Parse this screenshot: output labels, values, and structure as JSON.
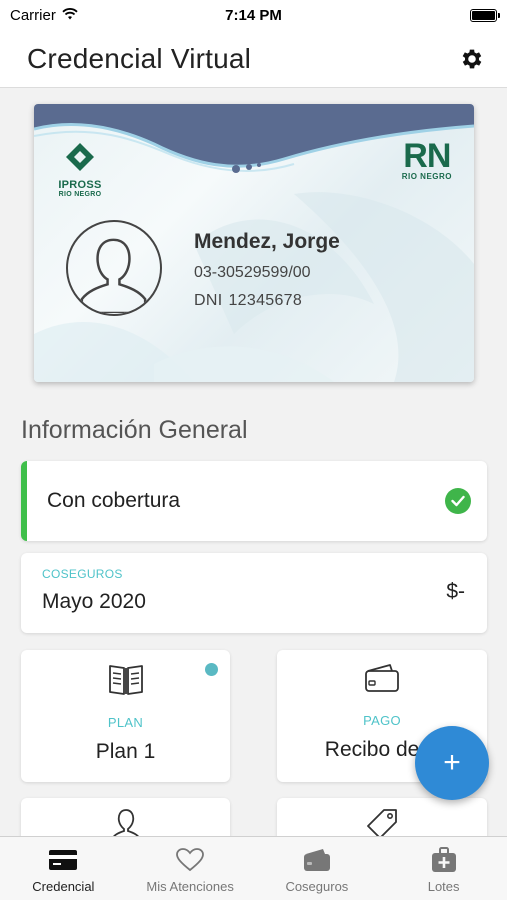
{
  "status_bar": {
    "carrier": "Carrier",
    "time": "7:14 PM"
  },
  "header": {
    "title": "Credencial Virtual"
  },
  "card": {
    "ipross_line1": "IPROSS",
    "ipross_line2": "RIO NEGRO",
    "rn_logo": "RN",
    "rn_sub": "RIO NEGRO",
    "name": "Mendez, Jorge",
    "number": "03-30529599/00",
    "dni_label": "DNI",
    "dni_value": "12345678"
  },
  "section_title": "Información General",
  "coverage": {
    "label": "Con cobertura"
  },
  "coseguros": {
    "label": "COSEGUROS",
    "month": "Mayo 2020",
    "amount": "$-"
  },
  "tiles": [
    {
      "label": "PLAN",
      "value": "Plan 1",
      "icon": "book-icon"
    },
    {
      "label": "PAGO",
      "value": "Recibo de S",
      "icon": "wallet-icon"
    }
  ],
  "bottom_tiles": [
    {
      "icon": "person-icon"
    },
    {
      "icon": "tag-icon"
    }
  ],
  "fab": {
    "label": "+"
  },
  "tab_bar": [
    {
      "label": "Credencial",
      "icon": "card-icon",
      "active": true
    },
    {
      "label": "Mis Atenciones",
      "icon": "heart-icon",
      "active": false
    },
    {
      "label": "Coseguros",
      "icon": "wallet-icon",
      "active": false
    },
    {
      "label": "Lotes",
      "icon": "medical-bag-icon",
      "active": false
    }
  ],
  "colors": {
    "accent_teal": "#4fc3c9",
    "coverage_green": "#3fb54a",
    "fab_blue": "#2f8ad6",
    "brand_green": "#1a6a4c"
  }
}
